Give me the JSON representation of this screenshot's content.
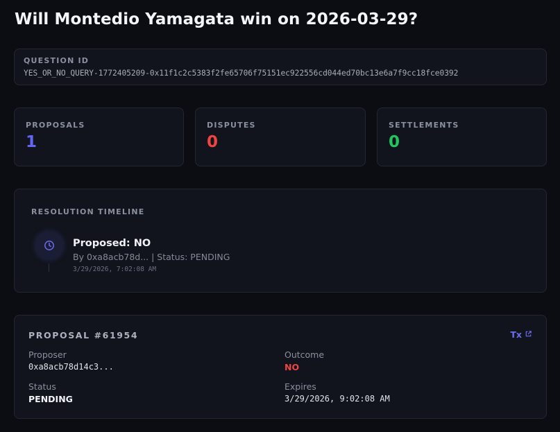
{
  "page": {
    "title": "Will Montedio Yamagata win on 2026-03-29?"
  },
  "question": {
    "label": "QUESTION ID",
    "value": "YES_OR_NO_QUERY-1772405209-0x11f1c2c5383f2fe65706f75151ec922556cd044ed70bc13e6a7f9cc18fce0392"
  },
  "stats": {
    "proposals": {
      "label": "PROPOSALS",
      "value": "1",
      "color": "#6366f1"
    },
    "disputes": {
      "label": "DISPUTES",
      "value": "0",
      "color": "#ef4444"
    },
    "settlements": {
      "label": "SETTLEMENTS",
      "value": "0",
      "color": "#22c55e"
    }
  },
  "timeline": {
    "label": "RESOLUTION TIMELINE",
    "events": [
      {
        "icon": "clock-icon",
        "title": "Proposed: NO",
        "subtitle": "By 0xa8acb78d... | Status: PENDING",
        "time": "3/29/2026, 7:02:08 AM"
      }
    ]
  },
  "proposal": {
    "title": "PROPOSAL #61954",
    "tx_label": "Tx",
    "proposer_label": "Proposer",
    "proposer_value": "0xa8acb78d14c3...",
    "outcome_label": "Outcome",
    "outcome_value": "NO",
    "outcome_color": "#ef4444",
    "status_label": "Status",
    "status_value": "PENDING",
    "expires_label": "Expires",
    "expires_value": "3/29/2026, 9:02:08 AM"
  },
  "colors": {
    "accent": "#6d6cf0",
    "background": "#0b0d13",
    "card": "#11141c"
  }
}
